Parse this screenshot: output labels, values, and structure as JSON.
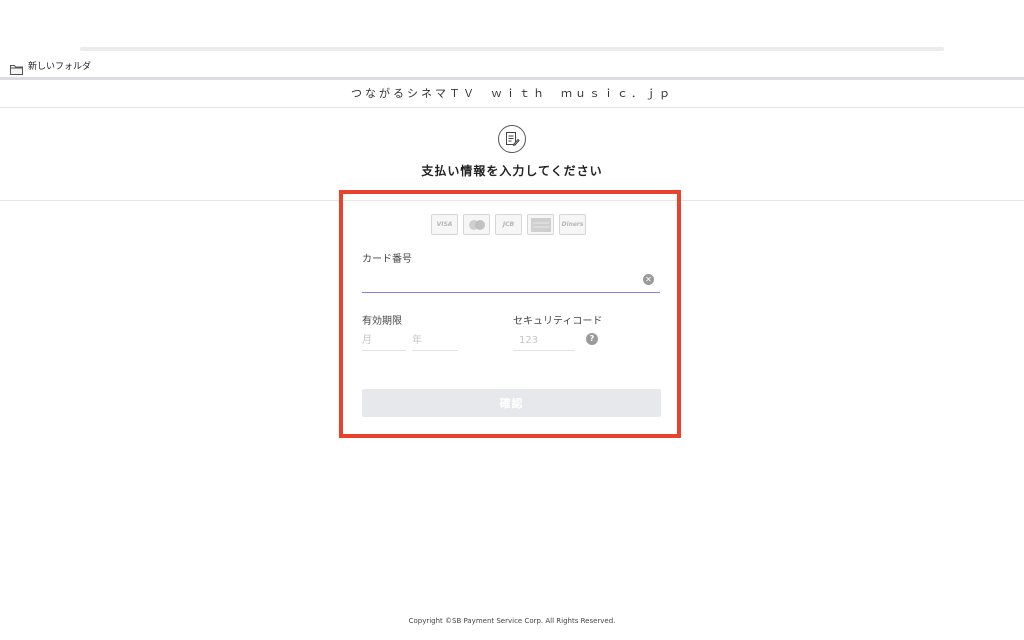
{
  "browser": {
    "bookmark_label": "新しいフォルダ"
  },
  "site": {
    "title": "つながるシネマＴＶ　ｗｉｔｈ　ｍｕｓｉｃ．ｊｐ"
  },
  "hero": {
    "icon": "document-edit-icon",
    "title": "支払い情報を入力してください"
  },
  "card_logos": [
    {
      "name": "visa-logo",
      "label": "VISA"
    },
    {
      "name": "mastercard-logo",
      "label": ""
    },
    {
      "name": "jcb-logo",
      "label": "JCB"
    },
    {
      "name": "amex-logo",
      "label": ""
    },
    {
      "name": "diners-logo",
      "label": "Diners"
    }
  ],
  "form": {
    "card_number_label": "カード番号",
    "card_number_value": "",
    "expiry_label": "有効期限",
    "month_placeholder": "月",
    "year_placeholder": "年",
    "security_label": "セキュリティコード",
    "security_placeholder": "123",
    "confirm_label": "確認"
  },
  "footer": {
    "copyright": "Copyright ©SB Payment Service Corp. All Rights Reserved."
  },
  "colors": {
    "highlight_frame": "#e8412c",
    "input_focus": "#8a7fd0",
    "button_disabled": "#e6e8eb"
  }
}
